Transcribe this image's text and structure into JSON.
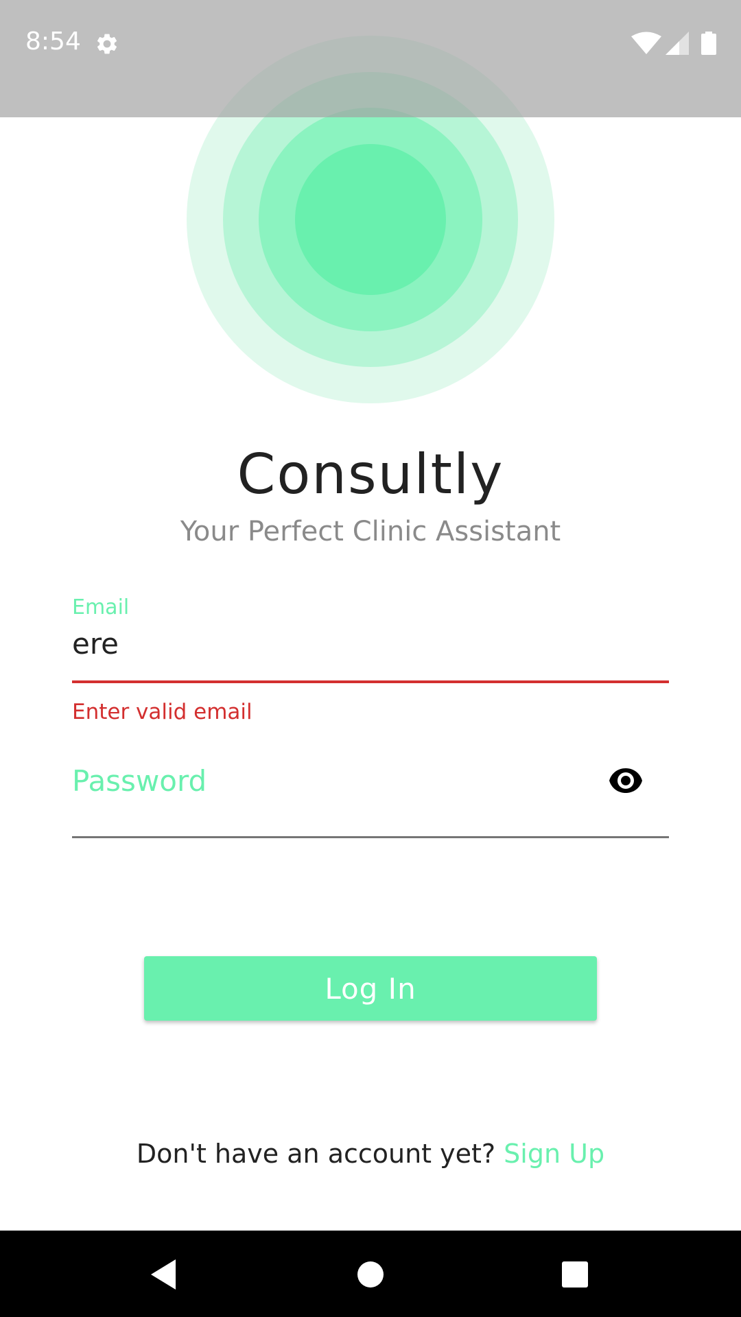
{
  "status_bar": {
    "time": "8:54",
    "icons": [
      "gear-icon",
      "wifi-icon",
      "cellular-signal-icon",
      "battery-icon"
    ]
  },
  "app": {
    "title": "Consultly",
    "subtitle": "Your Perfect Clinic Assistant",
    "accent_color": "#69f0ae",
    "error_color": "#d32f2f"
  },
  "form": {
    "email": {
      "label": "Email",
      "value": "ere",
      "error": "Enter valid email"
    },
    "password": {
      "placeholder": "Password",
      "value": "",
      "toggle_icon": "eye-icon"
    },
    "login_label": "Log In"
  },
  "signup": {
    "prompt": "Don't have an account yet? ",
    "link": "Sign Up"
  },
  "nav_bar": {
    "buttons": [
      "back-icon",
      "home-icon",
      "recents-icon"
    ]
  }
}
